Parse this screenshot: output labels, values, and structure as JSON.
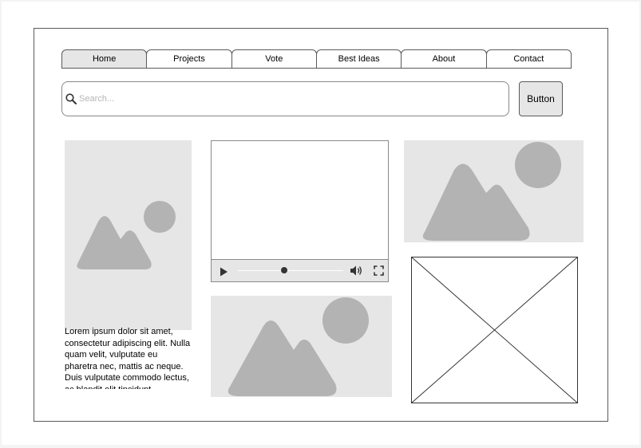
{
  "nav": {
    "tabs": [
      {
        "label": "Home",
        "active": true
      },
      {
        "label": "Projects",
        "active": false
      },
      {
        "label": "Vote",
        "active": false
      },
      {
        "label": "Best Ideas",
        "active": false
      },
      {
        "label": "About",
        "active": false
      },
      {
        "label": "Contact",
        "active": false
      }
    ]
  },
  "search": {
    "placeholder": "Search...",
    "value": "",
    "icon": "search-icon"
  },
  "button": {
    "label": "Button"
  },
  "content": {
    "lorem_text": "Lorem ipsum dolor sit amet, consectetur adipiscing elit. Nulla quam velit, vulputate eu pharetra nec, mattis ac neque. Duis vulputate commodo lectus, ac blandit elit tincidunt"
  },
  "video": {
    "progress": 0.44,
    "icons": [
      "play-icon",
      "volume-icon",
      "fullscreen-icon"
    ]
  },
  "colors": {
    "image_bg": "#e6e6e6",
    "image_shape": "#b3b3b3",
    "active_tab": "#e6e6e6",
    "border": "#5a5a5a"
  }
}
